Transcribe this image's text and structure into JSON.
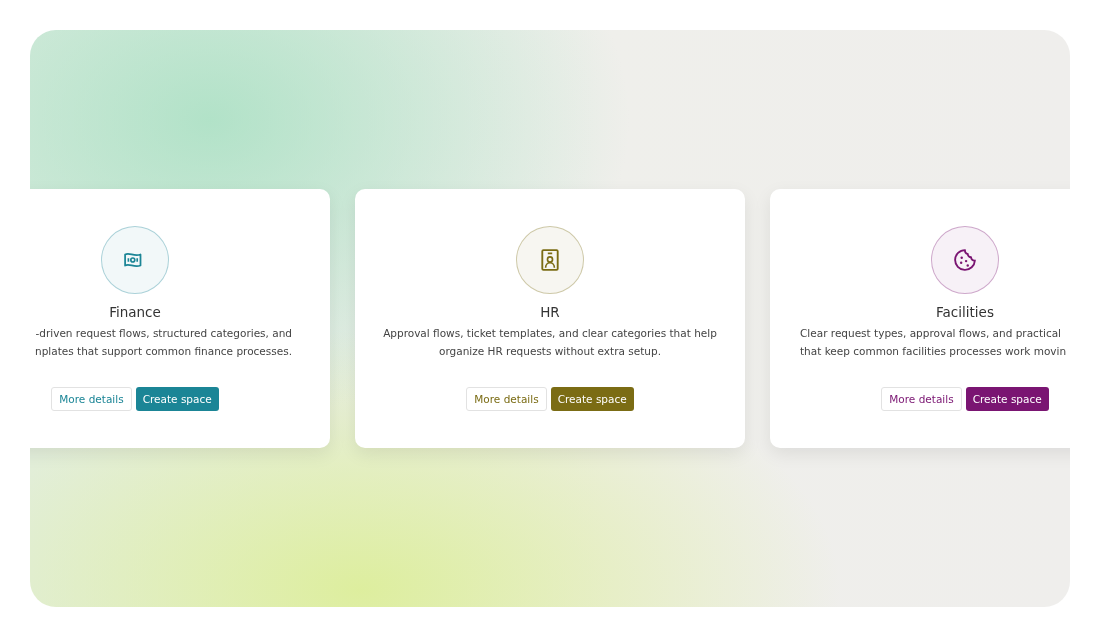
{
  "cards": [
    {
      "title": "Finance",
      "color": "#1b8596",
      "description": [
        "-driven request flows, structured categories, and",
        "nplates that support common finance processes."
      ],
      "buttons": [
        {
          "label": "More details",
          "kind": "secondary"
        },
        {
          "label": "Create space",
          "kind": "primary"
        }
      ]
    },
    {
      "title": "HR",
      "color": "#7b6c14",
      "description": [
        "Approval flows, ticket templates, and clear categories that help",
        "organize HR requests without extra setup."
      ],
      "buttons": [
        {
          "label": "More details",
          "kind": "secondary"
        },
        {
          "label": "Create space",
          "kind": "primary"
        }
      ]
    },
    {
      "title": "Facilities",
      "color": "#7a1572",
      "description": [
        "Clear request types, approval flows, and practical",
        "that keep common facilities processes work movin"
      ],
      "buttons": [
        {
          "label": "More details",
          "kind": "secondary"
        },
        {
          "label": "Create space",
          "kind": "primary"
        }
      ]
    }
  ]
}
